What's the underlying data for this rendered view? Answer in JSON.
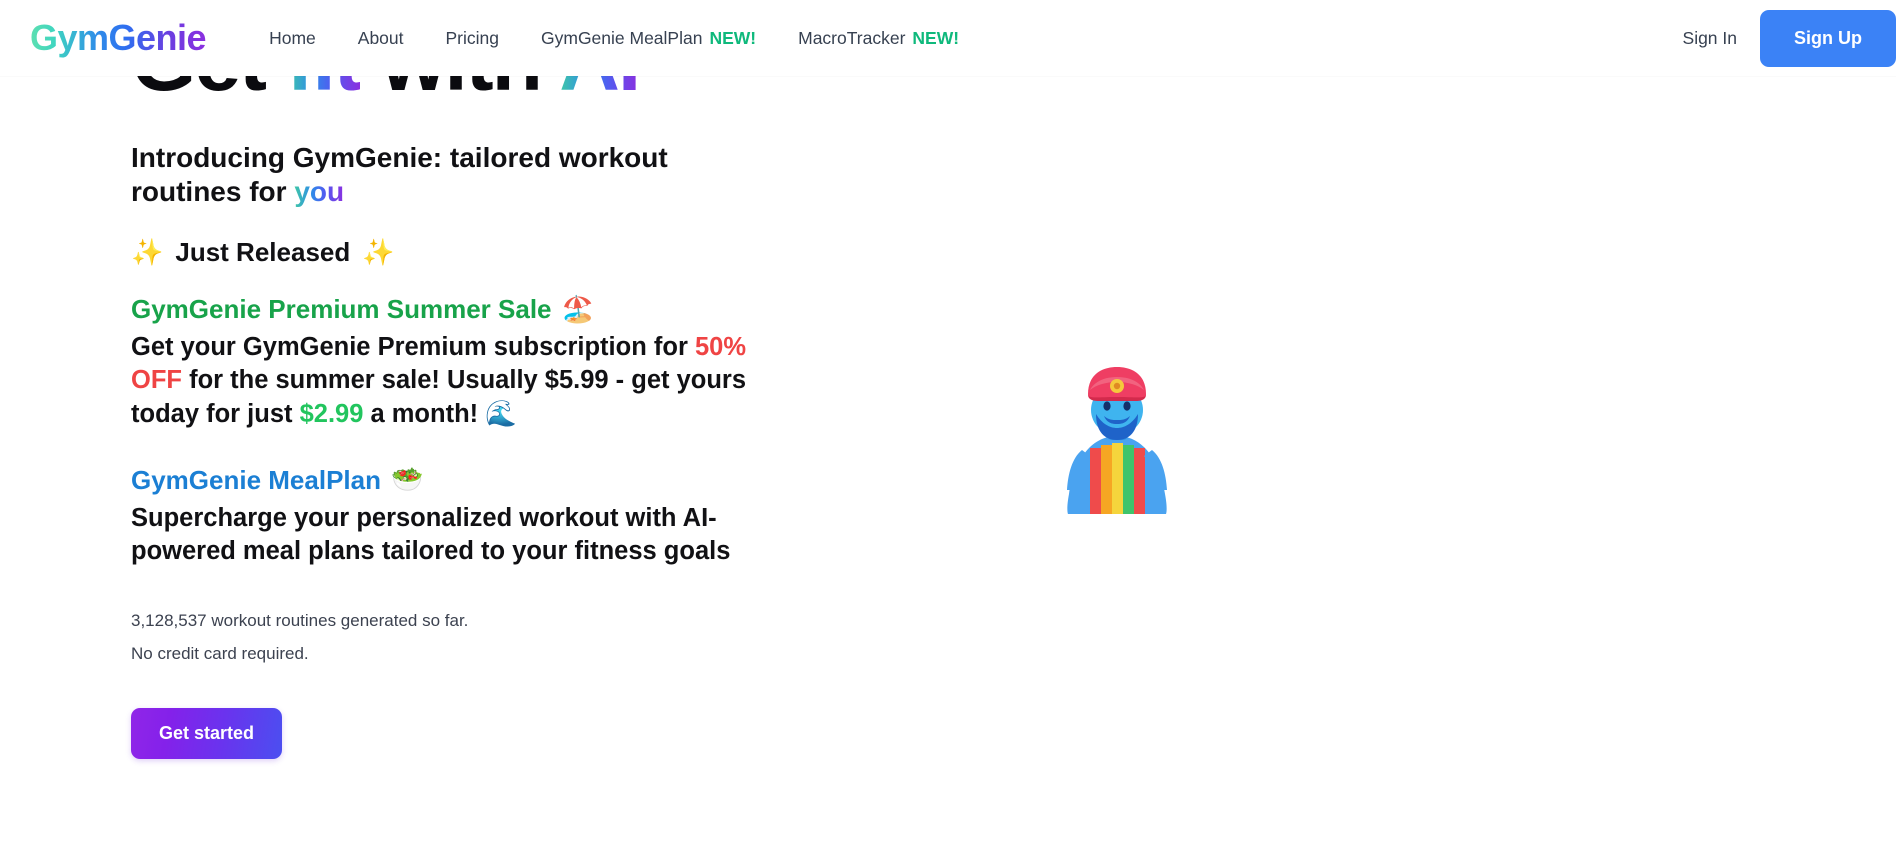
{
  "navbar": {
    "brand": "GymGenie",
    "links": [
      {
        "label": "Home",
        "badge": ""
      },
      {
        "label": "About",
        "badge": ""
      },
      {
        "label": "Pricing",
        "badge": ""
      },
      {
        "label": "GymGenie MealPlan",
        "badge": "NEW!"
      },
      {
        "label": "MacroTracker",
        "badge": "NEW!"
      }
    ],
    "sign_in": "Sign In",
    "sign_up": "Sign Up",
    "new_badge_color": "#0fb97c",
    "signup_bg": "#3b82f6"
  },
  "hero": {
    "title_plain_1": "Get ",
    "title_gradient_1": "fit",
    "title_plain_2": " with ",
    "title_gradient_2": "AI",
    "subheading_plain": "Introducing GymGenie: tailored workout routines for ",
    "subheading_gradient": "you",
    "just_released": "Just Released",
    "sparkle_emoji": "✨",
    "promo": {
      "sale_heading": "GymGenie Premium Summer Sale",
      "sale_heading_emoji": "🏖️",
      "sale_heading_color": "#18a34a",
      "body_part_1": "Get your GymGenie Premium subscription for ",
      "discount": "50% OFF",
      "discount_color": "#ef4444",
      "body_part_2": " for the summer sale! Usually $5.99 - get yours today for just ",
      "price": "$2.99",
      "price_color": "#22c55e",
      "body_part_3": " a month! ",
      "wave_emoji": "🌊"
    },
    "mealplan": {
      "heading": "GymGenie MealPlan",
      "heading_emoji": "🥗",
      "heading_color": "#1b7fd4",
      "body": "Supercharge your personalized workout with AI-powered meal plans tailored to your fitness goals"
    },
    "stats_routines": "3,128,537 workout routines generated so far.",
    "stats_nocard": "No credit card required.",
    "cta_label": "Get started",
    "cta_gradient_from": "#9026e8",
    "cta_gradient_to": "#4b4ff0",
    "genie_emoji": "🧞"
  }
}
